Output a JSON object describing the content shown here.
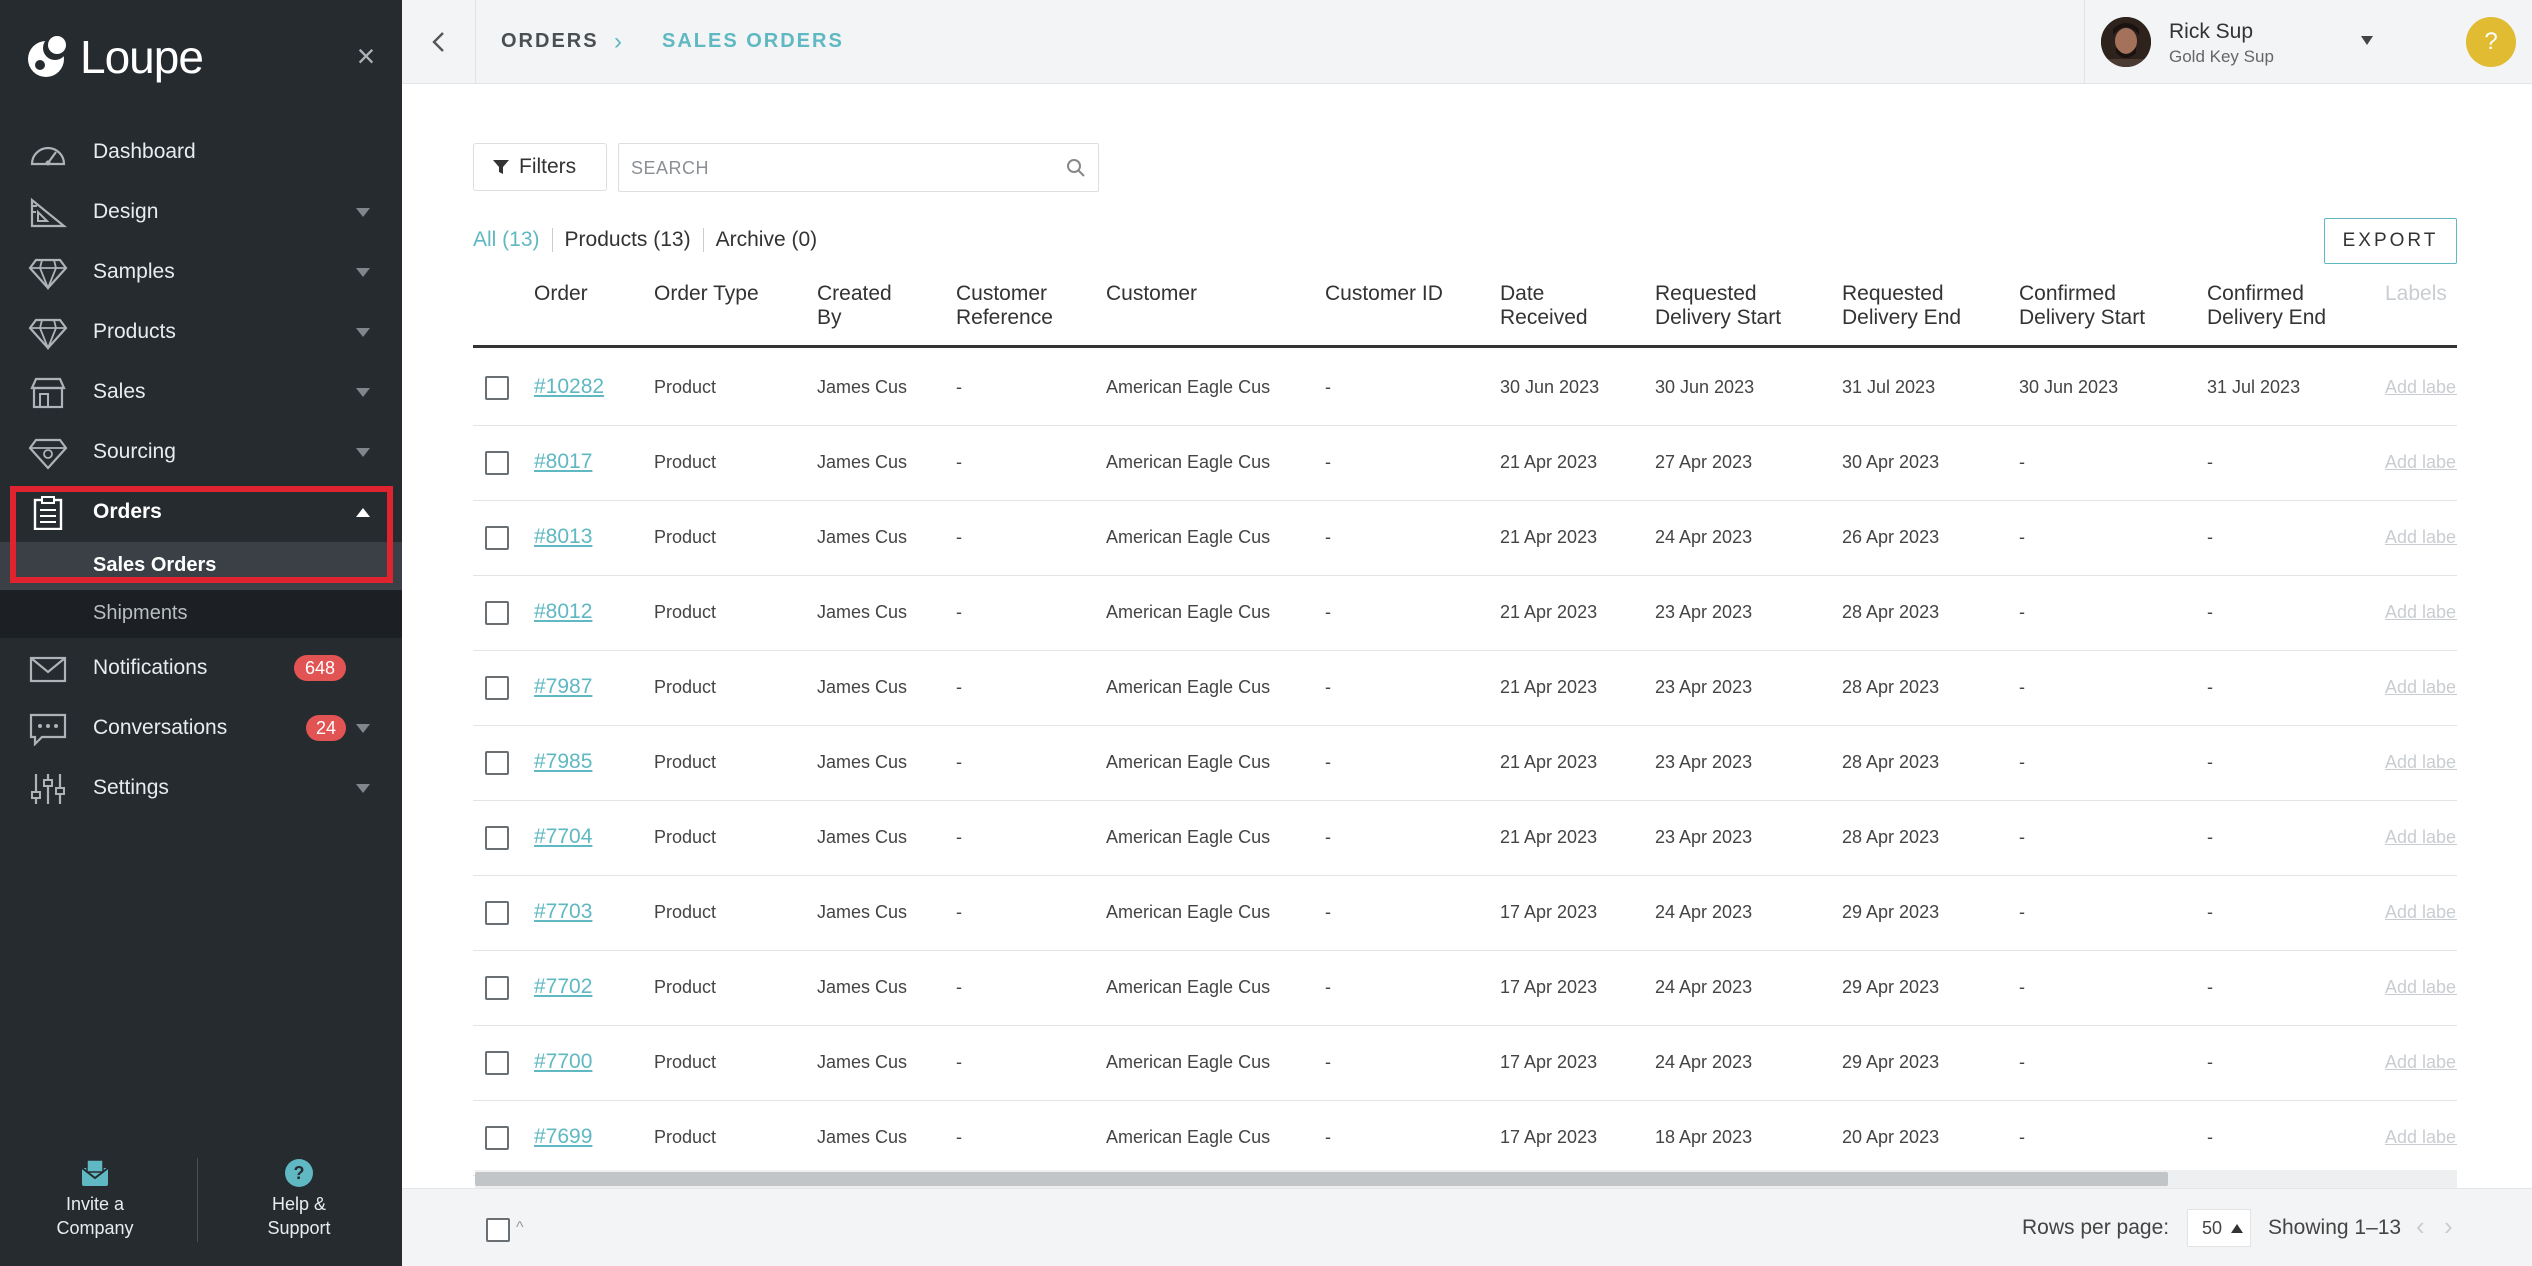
{
  "app": {
    "name": "Loupe"
  },
  "sidebar": {
    "items": [
      {
        "label": "Dashboard",
        "icon": "dashboard-icon",
        "has_caret": false
      },
      {
        "label": "Design",
        "icon": "design-icon",
        "has_caret": true
      },
      {
        "label": "Samples",
        "icon": "samples-icon",
        "has_caret": true
      },
      {
        "label": "Products",
        "icon": "products-icon",
        "has_caret": true
      },
      {
        "label": "Sales",
        "icon": "sales-icon",
        "has_caret": true
      },
      {
        "label": "Sourcing",
        "icon": "sourcing-icon",
        "has_caret": true
      },
      {
        "label": "Orders",
        "icon": "orders-icon",
        "expanded": true
      },
      {
        "label": "Notifications",
        "icon": "notifications-icon",
        "badge": "648"
      },
      {
        "label": "Conversations",
        "icon": "conversations-icon",
        "badge": "24",
        "has_caret": true
      },
      {
        "label": "Settings",
        "icon": "settings-icon",
        "has_caret": true
      }
    ],
    "orders_sub": [
      {
        "label": "Sales Orders",
        "selected": true
      },
      {
        "label": "Shipments",
        "selected": false
      }
    ],
    "footer": {
      "invite_line1": "Invite a",
      "invite_line2": "Company",
      "help_line1": "Help &",
      "help_line2": "Support"
    }
  },
  "header": {
    "breadcrumb": [
      "ORDERS",
      "SALES ORDERS"
    ],
    "user_name": "Rick Sup",
    "user_role": "Gold Key Sup",
    "help_label": "?"
  },
  "toolbar": {
    "filters_label": "Filters",
    "search_placeholder": "SEARCH",
    "export_label": "EXPORT"
  },
  "tabs": [
    {
      "label": "All (13)",
      "active": true
    },
    {
      "label": "Products (13)",
      "active": false
    },
    {
      "label": "Archive (0)",
      "active": false
    }
  ],
  "table": {
    "columns": [
      [
        "Order"
      ],
      [
        "Order Type"
      ],
      [
        "Created",
        "By"
      ],
      [
        "Customer",
        "Reference"
      ],
      [
        "Customer"
      ],
      [
        "Customer ID"
      ],
      [
        "Date",
        "Received"
      ],
      [
        "Requested",
        "Delivery Start"
      ],
      [
        "Requested",
        "Delivery End"
      ],
      [
        "Confirmed",
        "Delivery Start"
      ],
      [
        "Confirmed",
        "Delivery End"
      ],
      [
        "Labels"
      ]
    ],
    "add_label_text": "Add labels",
    "rows": [
      {
        "order": "#10282",
        "type": "Product",
        "created_by": "James Cus",
        "reference": "-",
        "customer": "American Eagle Cus",
        "customer_id": "-",
        "date_received": "30 Jun 2023",
        "req_start": "30 Jun 2023",
        "req_end": "31 Jul 2023",
        "conf_start": "30 Jun 2023",
        "conf_end": "31 Jul 2023"
      },
      {
        "order": "#8017",
        "type": "Product",
        "created_by": "James Cus",
        "reference": "-",
        "customer": "American Eagle Cus",
        "customer_id": "-",
        "date_received": "21 Apr 2023",
        "req_start": "27 Apr 2023",
        "req_end": "30 Apr 2023",
        "conf_start": "-",
        "conf_end": "-"
      },
      {
        "order": "#8013",
        "type": "Product",
        "created_by": "James Cus",
        "reference": "-",
        "customer": "American Eagle Cus",
        "customer_id": "-",
        "date_received": "21 Apr 2023",
        "req_start": "24 Apr 2023",
        "req_end": "26 Apr 2023",
        "conf_start": "-",
        "conf_end": "-"
      },
      {
        "order": "#8012",
        "type": "Product",
        "created_by": "James Cus",
        "reference": "-",
        "customer": "American Eagle Cus",
        "customer_id": "-",
        "date_received": "21 Apr 2023",
        "req_start": "23 Apr 2023",
        "req_end": "28 Apr 2023",
        "conf_start": "-",
        "conf_end": "-"
      },
      {
        "order": "#7987",
        "type": "Product",
        "created_by": "James Cus",
        "reference": "-",
        "customer": "American Eagle Cus",
        "customer_id": "-",
        "date_received": "21 Apr 2023",
        "req_start": "23 Apr 2023",
        "req_end": "28 Apr 2023",
        "conf_start": "-",
        "conf_end": "-"
      },
      {
        "order": "#7985",
        "type": "Product",
        "created_by": "James Cus",
        "reference": "-",
        "customer": "American Eagle Cus",
        "customer_id": "-",
        "date_received": "21 Apr 2023",
        "req_start": "23 Apr 2023",
        "req_end": "28 Apr 2023",
        "conf_start": "-",
        "conf_end": "-"
      },
      {
        "order": "#7704",
        "type": "Product",
        "created_by": "James Cus",
        "reference": "-",
        "customer": "American Eagle Cus",
        "customer_id": "-",
        "date_received": "21 Apr 2023",
        "req_start": "23 Apr 2023",
        "req_end": "28 Apr 2023",
        "conf_start": "-",
        "conf_end": "-"
      },
      {
        "order": "#7703",
        "type": "Product",
        "created_by": "James Cus",
        "reference": "-",
        "customer": "American Eagle Cus",
        "customer_id": "-",
        "date_received": "17 Apr 2023",
        "req_start": "24 Apr 2023",
        "req_end": "29 Apr 2023",
        "conf_start": "-",
        "conf_end": "-"
      },
      {
        "order": "#7702",
        "type": "Product",
        "created_by": "James Cus",
        "reference": "-",
        "customer": "American Eagle Cus",
        "customer_id": "-",
        "date_received": "17 Apr 2023",
        "req_start": "24 Apr 2023",
        "req_end": "29 Apr 2023",
        "conf_start": "-",
        "conf_end": "-"
      },
      {
        "order": "#7700",
        "type": "Product",
        "created_by": "James Cus",
        "reference": "-",
        "customer": "American Eagle Cus",
        "customer_id": "-",
        "date_received": "17 Apr 2023",
        "req_start": "24 Apr 2023",
        "req_end": "29 Apr 2023",
        "conf_start": "-",
        "conf_end": "-"
      },
      {
        "order": "#7699",
        "type": "Product",
        "created_by": "James Cus",
        "reference": "-",
        "customer": "American Eagle Cus",
        "customer_id": "-",
        "date_received": "17 Apr 2023",
        "req_start": "18 Apr 2023",
        "req_end": "20 Apr 2023",
        "conf_start": "-",
        "conf_end": "-"
      }
    ]
  },
  "footer_bar": {
    "rows_per_page_label": "Rows per page:",
    "rows_per_page_value": "50",
    "showing": "Showing 1–13"
  },
  "colors": {
    "accent": "#5fb8c2",
    "sidebar_bg": "#262b30",
    "badge": "#e25454",
    "highlight": "#e0242f",
    "help": "#e1bb31"
  }
}
